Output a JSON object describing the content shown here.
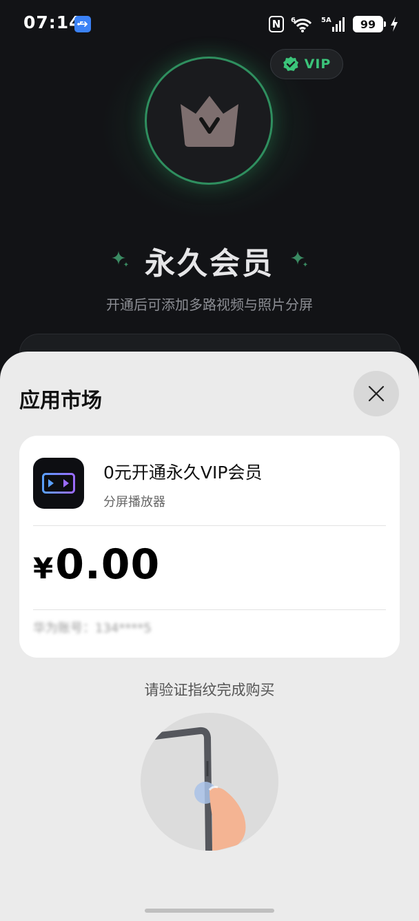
{
  "status_bar": {
    "time": "07:14",
    "usb_icon": "usb-icon",
    "nfc_label": "N",
    "network_label": "6",
    "cellular_label": "5A",
    "battery": "99"
  },
  "background_page": {
    "vip_badge": "VIP",
    "title": "永久会员",
    "subtitle": "开通后可添加多路视频与照片分屏",
    "accent_color": "#3bc47a"
  },
  "sheet": {
    "title": "应用市场",
    "close_icon": "close-icon",
    "product": {
      "name": "0元开通永久VIP会员",
      "app_name": "分屏播放器",
      "currency": "¥",
      "price": "0.00",
      "account_text": "华为账号：134****5"
    },
    "prompt": "请验证指纹完成购买",
    "fingerprint_icon": "fingerprint-sensor-illustration"
  }
}
